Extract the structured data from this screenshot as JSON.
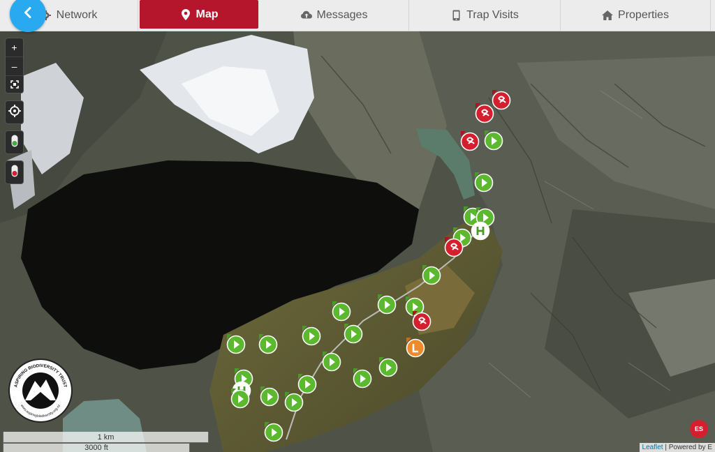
{
  "nav": {
    "tabs": [
      {
        "label": "Network",
        "icon": "gear-icon",
        "active": false
      },
      {
        "label": "Map",
        "icon": "map-pin-icon",
        "active": true
      },
      {
        "label": "Messages",
        "icon": "cloud-upload-icon",
        "active": false
      },
      {
        "label": "Trap Visits",
        "icon": "phone-icon",
        "active": false
      },
      {
        "label": "Properties",
        "icon": "home-icon",
        "active": false
      }
    ],
    "back_icon": "chevron-left-icon"
  },
  "map": {
    "zoom_in_label": "+",
    "zoom_out_label": "–",
    "scale_metric": "1 km",
    "scale_imperial": "3000 ft",
    "attribution_link": "Leaflet",
    "attribution_text": " | Powered by E",
    "logo_text": "ASPIRING BIODIVERSITY TRUST",
    "logo_url": "www.aspiringbiodiversity.org.nz",
    "esri_badge": "ES",
    "colors": {
      "active_tab": "#b5162b",
      "back_button": "#29a9f0",
      "marker_green": "#5cb82e",
      "marker_red": "#d41f2f",
      "marker_orange": "#ee8a2a",
      "marker_white": "#ffffff"
    }
  }
}
